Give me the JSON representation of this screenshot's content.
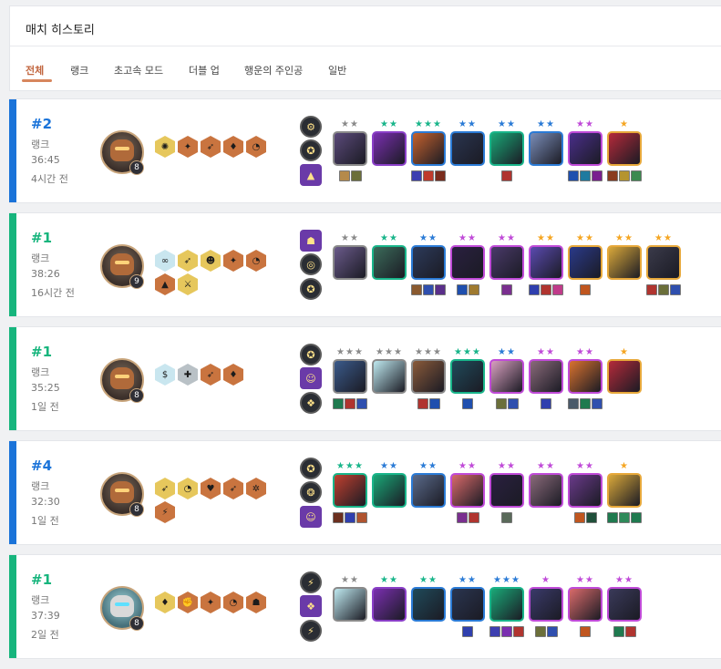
{
  "header": {
    "title": "매치 히스토리",
    "tabs": [
      {
        "label": "전체",
        "active": true
      },
      {
        "label": "랭크",
        "active": false
      },
      {
        "label": "초고속 모드",
        "active": false
      },
      {
        "label": "더블 업",
        "active": false
      },
      {
        "label": "행운의 주인공",
        "active": false
      },
      {
        "label": "일반",
        "active": false
      }
    ]
  },
  "colors": {
    "accent": "#c2663f",
    "top4": "#1a73d9",
    "win": "#17b57d",
    "star_1": "#f5a623",
    "star_2": "#2b7bd6",
    "star_3": "#19b58a",
    "star_grey": "#8a8a8a",
    "star_pink": "#c04bd8"
  },
  "matches": [
    {
      "placement": "#2",
      "mode": "랭크",
      "duration": "36:45",
      "ago": "4시간 전",
      "level": "8",
      "accent": "#1a73d9",
      "avatar": "tactician-bear",
      "traits": [
        [
          "gold",
          "✺"
        ],
        [
          "bronze",
          "✦"
        ],
        [
          "bronze",
          "➶"
        ],
        [
          "bronze",
          "♦"
        ],
        [
          "bronze",
          "◔"
        ]
      ],
      "augments": [
        [
          "circle",
          "⚙"
        ],
        [
          "circle",
          "✪"
        ],
        [
          "square",
          "▲"
        ]
      ],
      "units": [
        {
          "stars": "★★",
          "star_color": "#8a8a8a",
          "border": "#8a8a8a",
          "bg": "#5b4a7a",
          "items": [
            "#b58a4b",
            "#6b6f3a"
          ]
        },
        {
          "stars": "★★",
          "star_color": "#19b58a",
          "border": "#8a3fc7",
          "bg": "#7a2fb0",
          "items": []
        },
        {
          "stars": "★★★",
          "star_color": "#19b58a",
          "border": "#2b7bd6",
          "bg": "#c5622e",
          "items": [
            "#3d3fb0",
            "#c03b2b",
            "#7a2c1c"
          ]
        },
        {
          "stars": "★★",
          "star_color": "#2b7bd6",
          "border": "#2b7bd6",
          "bg": "#2a3550",
          "items": []
        },
        {
          "stars": "★★",
          "star_color": "#2b7bd6",
          "border": "#19b58a",
          "bg": "#1aa877",
          "items": [
            "#b0342f"
          ]
        },
        {
          "stars": "★★",
          "star_color": "#2b7bd6",
          "border": "#2b7bd6",
          "bg": "#7a8db8",
          "items": []
        },
        {
          "stars": "★★",
          "star_color": "#c04bd8",
          "border": "#c04bd8",
          "bg": "#4a2e8a",
          "items": [
            "#1f4fae",
            "#1f7a9f",
            "#7a1f8f"
          ]
        },
        {
          "stars": "★",
          "star_color": "#f5a623",
          "border": "#e7a83a",
          "bg": "#b52a3a",
          "items": [
            "#8a3b1f",
            "#b5942f",
            "#3b8a4f"
          ]
        }
      ]
    },
    {
      "placement": "#1",
      "mode": "랭크",
      "duration": "38:26",
      "ago": "16시간 전",
      "level": "9",
      "accent": "#17b57d",
      "avatar": "tactician-bear",
      "traits": [
        [
          "prism",
          "∞"
        ],
        [
          "gold",
          "➶"
        ],
        [
          "gold",
          "☻"
        ],
        [
          "bronze",
          "✦"
        ],
        [
          "bronze",
          "◔"
        ],
        [
          "bronze",
          "▲"
        ],
        [
          "gold",
          "⚔"
        ]
      ],
      "augments": [
        [
          "square",
          "☗"
        ],
        [
          "circle",
          "◎"
        ],
        [
          "circle",
          "✪"
        ]
      ],
      "units": [
        {
          "stars": "★★",
          "star_color": "#8a8a8a",
          "border": "#8a8a8a",
          "bg": "#6a5a8a",
          "items": []
        },
        {
          "stars": "★★",
          "star_color": "#19b58a",
          "border": "#19b58a",
          "bg": "#3b6b5a",
          "items": []
        },
        {
          "stars": "★★",
          "star_color": "#2b7bd6",
          "border": "#2b7bd6",
          "bg": "#2c3a5a",
          "items": [
            "#8a5a2f",
            "#2f4fae",
            "#5a2f8a"
          ]
        },
        {
          "stars": "★★",
          "star_color": "#c04bd8",
          "border": "#c04bd8",
          "bg": "#2a2040",
          "items": [
            "#1f4fae",
            "#9f7a2f"
          ]
        },
        {
          "stars": "★★",
          "star_color": "#c04bd8",
          "border": "#c04bd8",
          "bg": "#4a3a6a",
          "items": [
            "#7a2f8f"
          ]
        },
        {
          "stars": "★★",
          "star_color": "#f5a623",
          "border": "#c04bd8",
          "bg": "#5a4ab0",
          "items": [
            "#2f3fae",
            "#b0342f",
            "#c03b8a"
          ]
        },
        {
          "stars": "★★",
          "star_color": "#f5a623",
          "border": "#e7a83a",
          "bg": "#2a3a8a",
          "items": [
            "#c0561f"
          ]
        },
        {
          "stars": "★★",
          "star_color": "#f5a623",
          "border": "#e7a83a",
          "bg": "#d9a83a",
          "items": []
        },
        {
          "stars": "★★",
          "star_color": "#f5a623",
          "border": "#e7a83a",
          "bg": "#3a3a4a",
          "items": [
            "#b0342f",
            "#6b6f3a",
            "#2f4fae"
          ]
        }
      ]
    },
    {
      "placement": "#1",
      "mode": "랭크",
      "duration": "35:25",
      "ago": "1일 전",
      "level": "8",
      "accent": "#17b57d",
      "avatar": "tactician-bear",
      "traits": [
        [
          "prism",
          "$"
        ],
        [
          "silver",
          "✚"
        ],
        [
          "bronze",
          "➶"
        ],
        [
          "bronze",
          "♦"
        ]
      ],
      "augments": [
        [
          "circle",
          "✪"
        ],
        [
          "square",
          "☺"
        ],
        [
          "circle",
          "❖"
        ]
      ],
      "units": [
        {
          "stars": "★★★",
          "star_color": "#8a8a8a",
          "border": "#8a8a8a",
          "bg": "#3a5a8a",
          "items": [
            "#1f7a4f",
            "#b0342f",
            "#2f4fae"
          ]
        },
        {
          "stars": "★★★",
          "star_color": "#8a8a8a",
          "border": "#8a8a8a",
          "bg": "#bfe9f0",
          "items": []
        },
        {
          "stars": "★★★",
          "star_color": "#8a8a8a",
          "border": "#8a8a8a",
          "bg": "#8a5a3a",
          "items": [
            "#b0342f",
            "#1f4fae"
          ]
        },
        {
          "stars": "★★★",
          "star_color": "#19b58a",
          "border": "#19b58a",
          "bg": "#1f4a5a",
          "items": [
            "#1f4fae"
          ]
        },
        {
          "stars": "★★",
          "star_color": "#2b7bd6",
          "border": "#c04bd8",
          "bg": "#d9a0c0",
          "items": [
            "#6b6f3a",
            "#2f4fae"
          ]
        },
        {
          "stars": "★★",
          "star_color": "#c04bd8",
          "border": "#c04bd8",
          "bg": "#8a6a7a",
          "items": [
            "#2f3fae"
          ]
        },
        {
          "stars": "★★",
          "star_color": "#c04bd8",
          "border": "#c04bd8",
          "bg": "#d9722f",
          "items": [
            "#4a5a6a",
            "#1f7a4f",
            "#2f4fae"
          ]
        },
        {
          "stars": "★",
          "star_color": "#f5a623",
          "border": "#e7a83a",
          "bg": "#b52a3a",
          "items": []
        }
      ]
    },
    {
      "placement": "#4",
      "mode": "랭크",
      "duration": "32:30",
      "ago": "1일 전",
      "level": "8",
      "accent": "#1a73d9",
      "avatar": "tactician-bear",
      "traits": [
        [
          "gold",
          "➶"
        ],
        [
          "gold",
          "◔"
        ],
        [
          "bronze",
          "♥"
        ],
        [
          "bronze",
          "➶"
        ],
        [
          "bronze",
          "✲"
        ],
        [
          "bronze",
          "⚡"
        ]
      ],
      "augments": [
        [
          "circle",
          "✪"
        ],
        [
          "circle",
          "❂"
        ],
        [
          "square",
          "☺"
        ]
      ],
      "units": [
        {
          "stars": "★★★",
          "star_color": "#19b58a",
          "border": "#19b58a",
          "bg": "#c0402f",
          "items": [
            "#6b2f1f",
            "#2f3fae",
            "#b0542f"
          ]
        },
        {
          "stars": "★★",
          "star_color": "#2b7bd6",
          "border": "#19b58a",
          "bg": "#1aa877",
          "items": []
        },
        {
          "stars": "★★",
          "star_color": "#2b7bd6",
          "border": "#2b7bd6",
          "bg": "#5a6a8a",
          "items": []
        },
        {
          "stars": "★★",
          "star_color": "#c04bd8",
          "border": "#c04bd8",
          "bg": "#d96a6a",
          "items": [
            "#7a2f8f",
            "#b0342f"
          ]
        },
        {
          "stars": "★★",
          "star_color": "#c04bd8",
          "border": "#c04bd8",
          "bg": "#2a2040",
          "items": [
            "#5a6a5a"
          ]
        },
        {
          "stars": "★★",
          "star_color": "#c04bd8",
          "border": "#c04bd8",
          "bg": "#8a6a7a",
          "items": []
        },
        {
          "stars": "★★",
          "star_color": "#c04bd8",
          "border": "#c04bd8",
          "bg": "#6a3a8a",
          "items": [
            "#c0561f",
            "#1f4f3a"
          ]
        },
        {
          "stars": "★",
          "star_color": "#f5a623",
          "border": "#e7a83a",
          "bg": "#d9a83a",
          "items": [
            "#1f7a4f",
            "#2f8a5a",
            "#1f7a4f"
          ]
        }
      ]
    },
    {
      "placement": "#1",
      "mode": "랭크",
      "duration": "37:39",
      "ago": "2일 전",
      "level": "8",
      "accent": "#17b57d",
      "avatar": "tactician-robot",
      "traits": [
        [
          "gold",
          "♦"
        ],
        [
          "bronze",
          "✊"
        ],
        [
          "bronze",
          "✦"
        ],
        [
          "bronze",
          "◔"
        ],
        [
          "bronze",
          "☗"
        ]
      ],
      "augments": [
        [
          "circle",
          "⚡"
        ],
        [
          "square",
          "❖"
        ],
        [
          "circle",
          "⚡"
        ]
      ],
      "units": [
        {
          "stars": "★★",
          "star_color": "#8a8a8a",
          "border": "#8a8a8a",
          "bg": "#bfe9f0",
          "items": []
        },
        {
          "stars": "★★",
          "star_color": "#19b58a",
          "border": "#8a3fc7",
          "bg": "#7a2fb0",
          "items": []
        },
        {
          "stars": "★★",
          "star_color": "#19b58a",
          "border": "#2b7bd6",
          "bg": "#1f4a5a",
          "items": []
        },
        {
          "stars": "★★",
          "star_color": "#2b7bd6",
          "border": "#2b7bd6",
          "bg": "#2a3550",
          "items": [
            "#2f3fae"
          ]
        },
        {
          "stars": "★★★",
          "star_color": "#2b7bd6",
          "border": "#19b58a",
          "bg": "#1aa877",
          "items": [
            "#3d3fb0",
            "#7a2fb0",
            "#b0342f"
          ]
        },
        {
          "stars": "★",
          "star_color": "#c04bd8",
          "border": "#c04bd8",
          "bg": "#3a3a6a",
          "items": [
            "#6b6f3a",
            "#2f4fae"
          ]
        },
        {
          "stars": "★★",
          "star_color": "#c04bd8",
          "border": "#c04bd8",
          "bg": "#d96a6a",
          "items": [
            "#c0561f"
          ]
        },
        {
          "stars": "★★",
          "star_color": "#c04bd8",
          "border": "#c04bd8",
          "bg": "#3a3a5a",
          "items": [
            "#1f7a4f",
            "#b0342f"
          ]
        }
      ]
    }
  ]
}
